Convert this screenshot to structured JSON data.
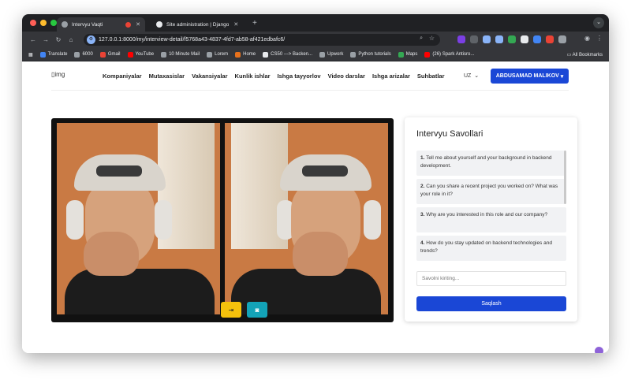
{
  "browser": {
    "tabs": [
      {
        "title": "Intervyu Vaqti",
        "active": true
      },
      {
        "title": "Site administration | Django",
        "active": false
      }
    ],
    "new_tab": "+",
    "url": "127.0.0.1:8000/my/interview-detail/f5768a43-4837-4fd7-ab58-af421edbafc6/",
    "bookmarks": [
      {
        "label": "Translate",
        "color": "#4285f4"
      },
      {
        "label": "6000",
        "color": "#9aa0a6"
      },
      {
        "label": "Gmail",
        "color": "#ea4335"
      },
      {
        "label": "YouTube",
        "color": "#ff0000"
      },
      {
        "label": "10 Minute Mail",
        "color": "#9aa0a6"
      },
      {
        "label": "Lorem",
        "color": "#9aa0a6"
      },
      {
        "label": "Home",
        "color": "#e8711c"
      },
      {
        "label": "CS50 ---> Backen...",
        "color": "#e8eaed"
      },
      {
        "label": "Upwork",
        "color": "#9aa0a6"
      },
      {
        "label": "Python tutorials",
        "color": "#9aa0a6"
      },
      {
        "label": "Maps",
        "color": "#34a853"
      },
      {
        "label": "(26) Spark Antisro...",
        "color": "#ff0000"
      }
    ],
    "all_bookmarks": "All Bookmarks"
  },
  "site": {
    "logo_alt": "img",
    "nav": [
      "Kompaniyalar",
      "Mutaxasislar",
      "Vakansiyalar",
      "Kunlik ishlar",
      "Ishga tayyorlov",
      "Video darslar",
      "Ishga arizalar",
      "Suhbatlar"
    ],
    "lang": "UZ",
    "user": "ABDUSAMAD MALIKOV"
  },
  "interview": {
    "title": "Intervyu Savollari",
    "questions": [
      {
        "num": "1.",
        "text": "Tell me about yourself and your background in backend development."
      },
      {
        "num": "2.",
        "text": "Can you share a recent project you worked on? What was your role in it?"
      },
      {
        "num": "3.",
        "text": "Why are you interested in this role and our company?"
      },
      {
        "num": "4.",
        "text": "How do you stay updated on backend technologies and trends?"
      }
    ],
    "input_placeholder": "Savolni kiriting...",
    "save_label": "Saqlash"
  },
  "colors": {
    "primary": "#1a47d6",
    "exit_button": "#f5c10c",
    "camera_button": "#13a3b8"
  }
}
